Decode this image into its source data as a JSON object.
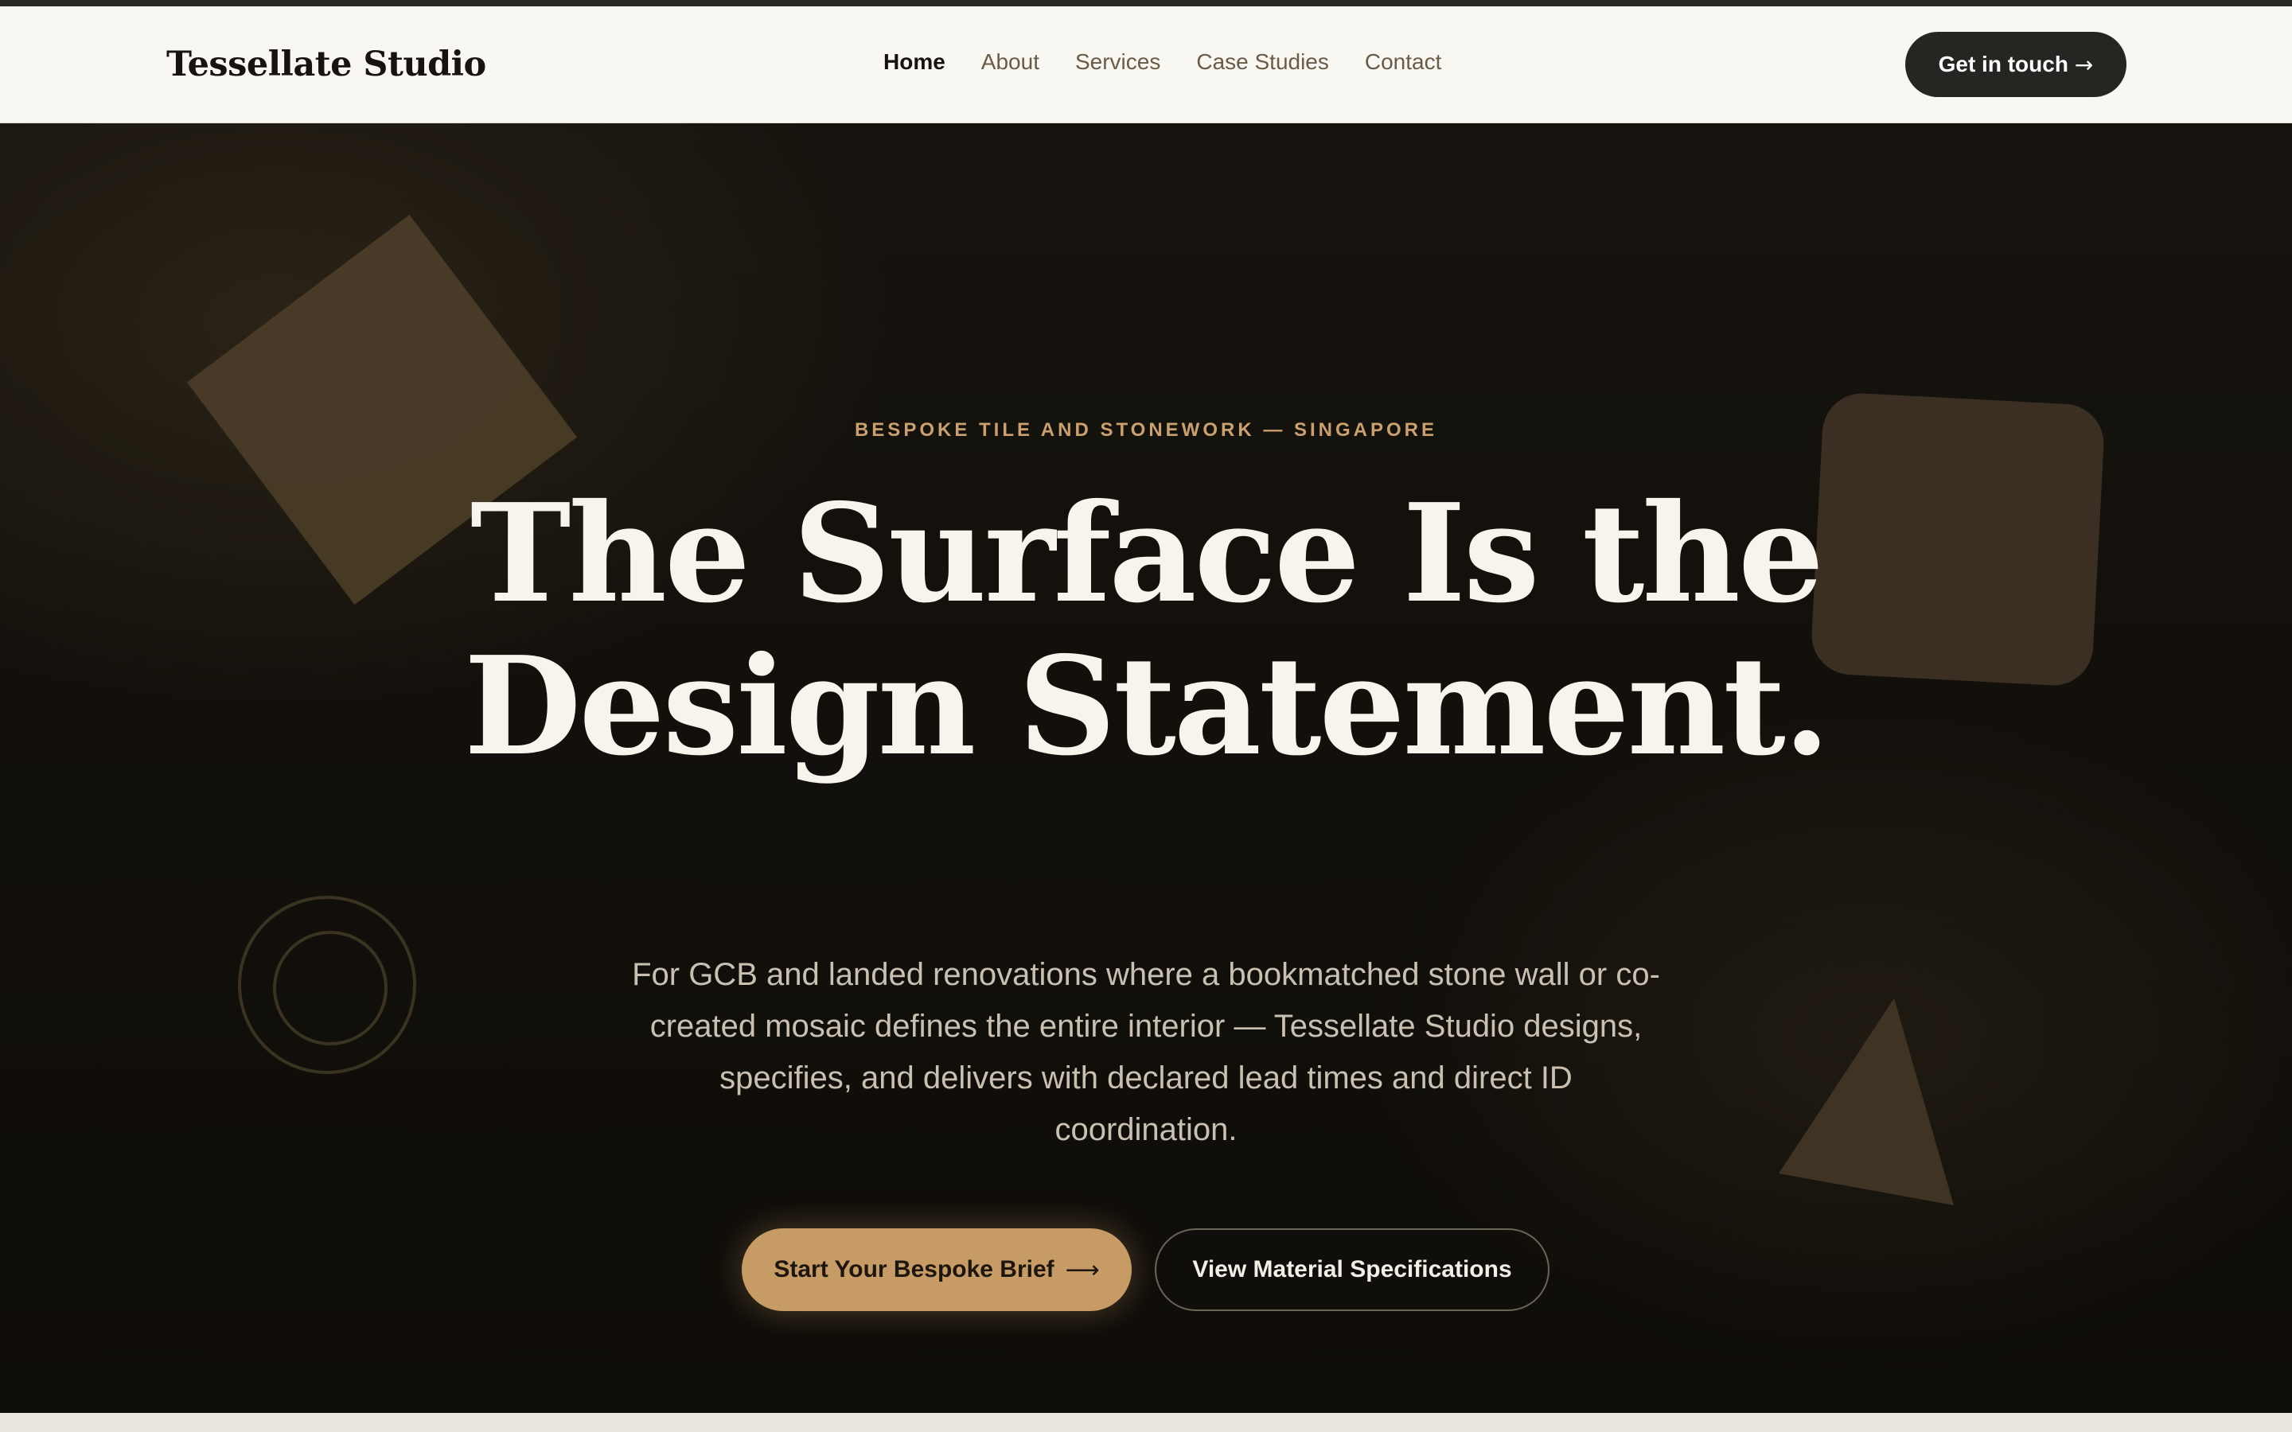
{
  "header": {
    "brand": "Tessellate Studio",
    "nav": [
      {
        "label": "Home",
        "active": true
      },
      {
        "label": "About"
      },
      {
        "label": "Services"
      },
      {
        "label": "Case Studies"
      },
      {
        "label": "Contact"
      }
    ],
    "cta_label": "Get in touch",
    "cta_icon": "arrow-right-icon"
  },
  "hero": {
    "eyebrow": "BESPOKE TILE AND STONEWORK — SINGAPORE",
    "headline_line1": "The Surface Is the",
    "headline_line2": "Design Statement.",
    "lede": "For GCB and landed renovations where a bookmatched stone wall or co-created mosaic defines the entire interior — Tessellate Studio designs, specifies, and delivers with declared lead times and direct ID coordination.",
    "primary_cta": "Start Your Bespoke Brief",
    "secondary_cta": "View Material Specifications"
  },
  "colors": {
    "accent": "#c79b66",
    "dark": "#0f0d09",
    "header_bg": "#f9f7f2",
    "eyebrow": "#c9a06e"
  }
}
